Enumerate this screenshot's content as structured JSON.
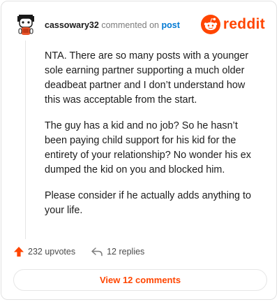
{
  "header": {
    "username": "cassowary32",
    "action_text": "commented on",
    "post_link": "post",
    "brand": "reddit"
  },
  "comment": {
    "paragraphs": [
      "NTA. There are so many posts with a younger sole earning partner supporting a much older deadbeat partner and I don’t understand how this was acceptable from the start.",
      "The guy has a kid and no job? So he hasn’t been paying child support for his kid for the entirety of your relationship? No wonder his ex dumped the kid on you and blocked him.",
      "Please consider if he actually adds anything to your life."
    ]
  },
  "actions": {
    "upvotes": "232 upvotes",
    "replies": "12 replies"
  },
  "footer": {
    "view_comments": "View 12 comments"
  },
  "colors": {
    "brand": "#ff4500",
    "link": "#0079d3",
    "text": "#1c1c1c",
    "muted": "#7c7c7c"
  },
  "icons": {
    "avatar": "snoo-avatar-icon",
    "logo": "reddit-alien-icon",
    "upvote": "upvote-arrow-icon",
    "reply": "reply-arrow-icon"
  }
}
